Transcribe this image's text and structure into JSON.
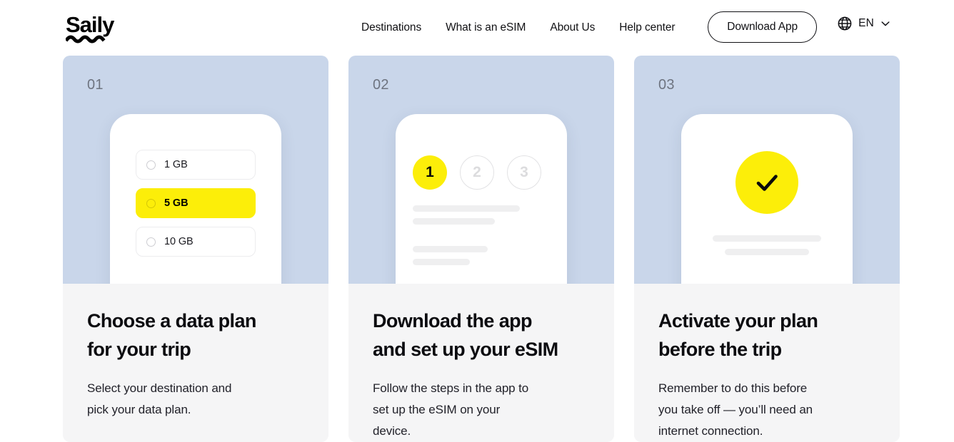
{
  "brand": {
    "name": "Saily"
  },
  "header": {
    "nav": [
      {
        "label": "Destinations"
      },
      {
        "label": "What is an eSIM"
      },
      {
        "label": "About Us"
      },
      {
        "label": "Help center"
      }
    ],
    "download_label": "Download App",
    "language": {
      "code": "EN",
      "globe_icon": "globe-icon",
      "chevron_icon": "chevron-down-icon"
    }
  },
  "colors": {
    "accent_yellow": "#FCEE09",
    "illustration_blue": "#C9D6EA",
    "body_grey": "#F5F5F6",
    "skeleton_grey": "#EFEFF0",
    "text_dark": "#0C0C10",
    "step_number_grey": "#6E7480"
  },
  "steps": [
    {
      "number": "01",
      "title": "Choose a data plan\nfor your trip",
      "description": "Select your destination and\npick your data plan.",
      "illustration": {
        "type": "plan-picker",
        "plans": [
          {
            "label": "1 GB",
            "selected": false
          },
          {
            "label": "5 GB",
            "selected": true
          },
          {
            "label": "10 GB",
            "selected": false
          }
        ]
      }
    },
    {
      "number": "02",
      "title": "Download the app\nand set up your eSIM",
      "description": "Follow the steps in the app to\nset up the eSIM on your\ndevice.",
      "illustration": {
        "type": "step-indicator",
        "circles": [
          {
            "label": "1",
            "active": true
          },
          {
            "label": "2",
            "active": false
          },
          {
            "label": "3",
            "active": false
          }
        ],
        "skeleton_group_1": [
          150,
          115
        ],
        "skeleton_group_2": [
          105,
          80
        ]
      }
    },
    {
      "number": "03",
      "title": "Activate your plan\nbefore the trip",
      "description": "Remember to do this before\nyou take off — you’ll need an\ninternet connection.",
      "illustration": {
        "type": "success-check",
        "check_icon": "check-icon",
        "skeleton_lines": [
          152,
          118
        ]
      }
    }
  ]
}
